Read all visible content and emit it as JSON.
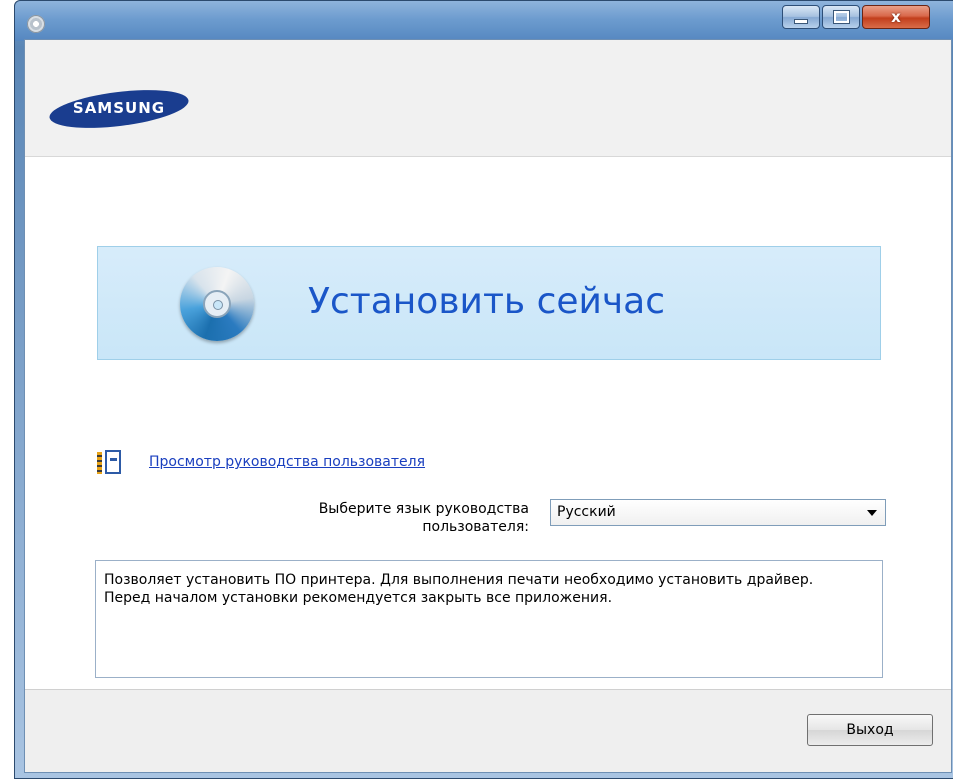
{
  "window": {
    "title": "",
    "controls": {
      "minimize": "minimize",
      "maximize": "maximize",
      "close": "x"
    }
  },
  "logo": {
    "brand": "SAMSUNG"
  },
  "install": {
    "label": "Установить сейчас"
  },
  "manual": {
    "link": "Просмотр руководства пользователя"
  },
  "language": {
    "label_line1": "Выберите язык руководства",
    "label_line2": "пользователя:",
    "selected": "Русский"
  },
  "description": {
    "line1": "Позволяет установить ПО принтера. Для выполнения печати необходимо установить драйвер.",
    "line2": "Перед началом установки рекомендуется закрыть все приложения."
  },
  "footer": {
    "exit_label": "Выход"
  },
  "icons": [
    "app-icon",
    "cd-disc-icon",
    "user-manual-icon",
    "dropdown-arrow-icon"
  ],
  "colors": {
    "accent": "#1a56c8",
    "brand": "#1a3d8f",
    "panel": "#c9e6f8"
  }
}
